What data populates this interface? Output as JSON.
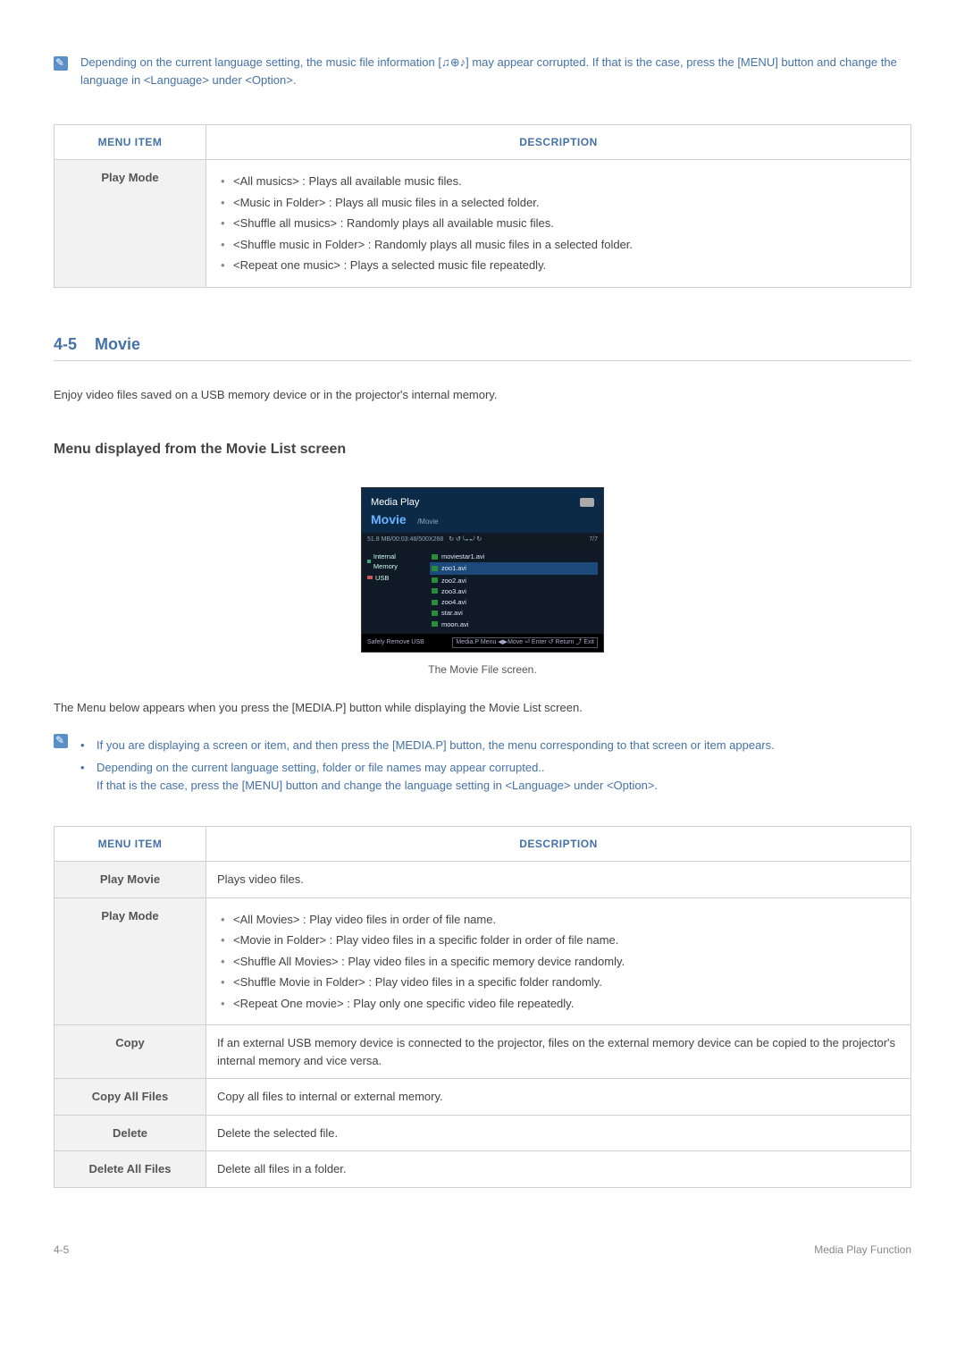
{
  "top_note": "Depending on the current language setting, the music file information [♫⊕♪] may appear corrupted. If that is the case, press the [MENU] button and change the language in <Language> under <Option>.",
  "table1": {
    "headers": [
      "MENU ITEM",
      "DESCRIPTION"
    ],
    "rows": [
      {
        "label": "Play Mode",
        "bullets": [
          "<All musics> : Plays all available music files.",
          "<Music in Folder> : Plays all music files in a selected folder.",
          "<Shuffle all musics> : Randomly plays all available music files.",
          "<Shuffle music in Folder> : Randomly plays all music files in a selected folder.",
          "<Repeat one music> : Plays a selected music file repeatedly."
        ]
      }
    ]
  },
  "section": {
    "num": "4-5",
    "title": "Movie"
  },
  "intro": "Enjoy video files saved on a USB memory device or in the projector's internal memory.",
  "subheading": "Menu displayed from the Movie List screen",
  "movie_screen": {
    "app": "Media Play",
    "category": "Movie",
    "path": "/Movie",
    "info": "51.8 MB/00:03:48/500X268",
    "icons": "↻ ↺ ⤿ ⤾ ↻",
    "counter": "7/7",
    "devices": [
      "Internal Memory",
      "USB"
    ],
    "files": [
      "moviestar1.avi",
      "zoo1.avi",
      "zoo2.avi",
      "zoo3.avi",
      "zoo4.avi",
      "star.avi",
      "moon.avi"
    ],
    "footer_left": "Safely Remove USB",
    "footer_right": "Media.P Menu  ◀▶Move  ⏎ Enter  ↺ Return  ⤴ Exit"
  },
  "caption": "The Movie File screen.",
  "list_intro": "The Menu below appears when you press the [MEDIA.P] button while displaying the Movie List screen.",
  "notes": [
    "If you are displaying a screen or item, and then press the [MEDIA.P] button, the menu corresponding to that screen or item appears.",
    "Depending on the current language setting, folder or file names may appear corrupted..",
    "If that is the case, press the [MENU] button and change the language setting in <Language> under <Option>."
  ],
  "table2": {
    "headers": [
      "MENU ITEM",
      "DESCRIPTION"
    ],
    "rows": [
      {
        "label": "Play Movie",
        "text": "Plays video files."
      },
      {
        "label": "Play Mode",
        "bullets": [
          "<All Movies> : Play video files in order of file name.",
          "<Movie in Folder> : Play video files in a specific folder in order of file name.",
          "<Shuffle All Movies> : Play video files in a specific memory device randomly.",
          "<Shuffle Movie in Folder> : Play video files in a specific folder randomly.",
          "<Repeat One movie> : Play only one specific video file repeatedly."
        ]
      },
      {
        "label": "Copy",
        "text": "If an external USB memory device is connected to the projector, files on the external memory device can be copied to the projector's internal memory and vice versa."
      },
      {
        "label": "Copy All Files",
        "text": "Copy all files to internal or external memory."
      },
      {
        "label": "Delete",
        "text": "Delete the selected file."
      },
      {
        "label": "Delete All Files",
        "text": "Delete all files in a folder."
      }
    ]
  },
  "footer": {
    "left": "4-5",
    "right": "Media Play Function"
  }
}
